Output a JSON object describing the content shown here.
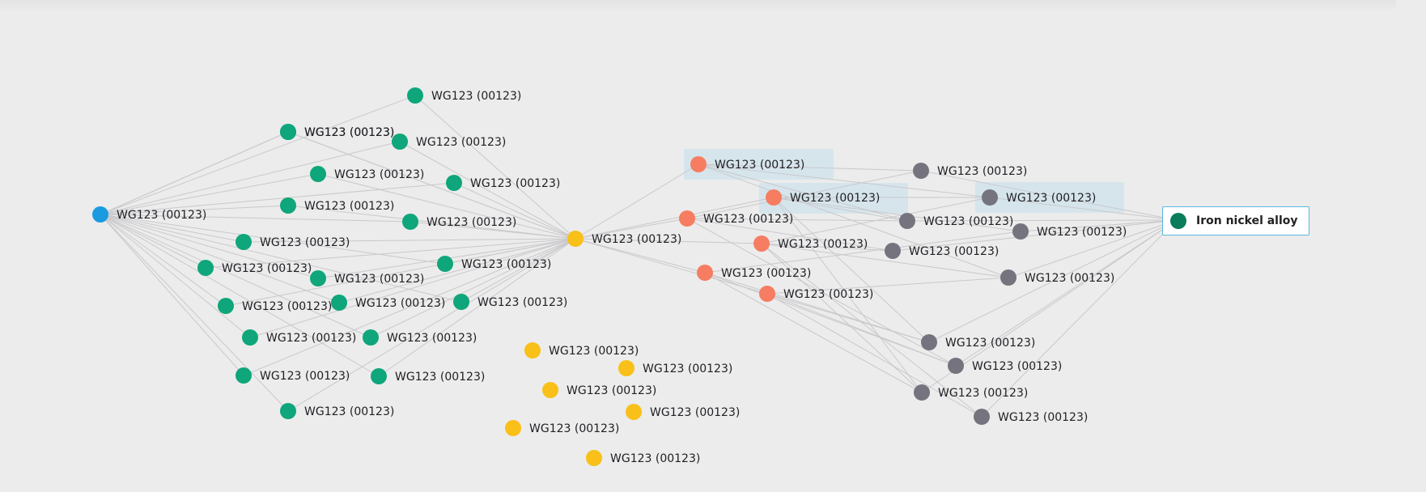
{
  "colors": {
    "background": "#ececec",
    "root": "#1a9be0",
    "hub": "#f8c018",
    "green": "#0ea67a",
    "orange": "#f67d62",
    "gray": "#74737e",
    "edge": "#c9c9cc",
    "legend_dot": "#0b7d5b",
    "legend_border": "#5ab7e0"
  },
  "legend": {
    "label": "Iron nickel alloy",
    "dot_color": "#0b7d5b"
  },
  "nodes": [
    {
      "id": "root",
      "label": "WG123 (00123)",
      "group": "root"
    },
    {
      "id": "g1",
      "label": "WG123 (00123)",
      "group": "green"
    },
    {
      "id": "g2",
      "label": "WG123 (00123)",
      "group": "green"
    },
    {
      "id": "g3",
      "label": "WG123 (00123)",
      "group": "green"
    },
    {
      "id": "g4",
      "label": "WG123 (00123)",
      "group": "green"
    },
    {
      "id": "g5",
      "label": "WG123 (00123)",
      "group": "green"
    },
    {
      "id": "g6",
      "label": "WG123 (00123)",
      "group": "green"
    },
    {
      "id": "g7",
      "label": "WG123 (00123)",
      "group": "green"
    },
    {
      "id": "g8",
      "label": "WG123 (00123)",
      "group": "green"
    },
    {
      "id": "g9",
      "label": "WG123 (00123)",
      "group": "green"
    },
    {
      "id": "g10",
      "label": "WG123 (00123)",
      "group": "green"
    },
    {
      "id": "g11",
      "label": "WG123 (00123)",
      "group": "green"
    },
    {
      "id": "g12",
      "label": "WG123 (00123)",
      "group": "green"
    },
    {
      "id": "g13",
      "label": "WG123 (00123)",
      "group": "green"
    },
    {
      "id": "g14",
      "label": "WG123 (00123)",
      "group": "green"
    },
    {
      "id": "g15",
      "label": "WG123 (00123)",
      "group": "green"
    },
    {
      "id": "g16",
      "label": "WG123 (00123)",
      "group": "green"
    },
    {
      "id": "g17",
      "label": "WG123 (00123)",
      "group": "green"
    },
    {
      "id": "g18",
      "label": "WG123 (00123)",
      "group": "green"
    },
    {
      "id": "g19",
      "label": "WG123 (00123)",
      "group": "green"
    },
    {
      "id": "g20",
      "label": "WG123 (00123)",
      "group": "green"
    },
    {
      "id": "hub",
      "label": "WG123 (00123)",
      "group": "hub"
    },
    {
      "id": "y1",
      "label": "WG123 (00123)",
      "group": "hub"
    },
    {
      "id": "y2",
      "label": "WG123 (00123)",
      "group": "hub"
    },
    {
      "id": "y3",
      "label": "WG123 (00123)",
      "group": "hub"
    },
    {
      "id": "y4",
      "label": "WG123 (00123)",
      "group": "hub"
    },
    {
      "id": "y5",
      "label": "WG123 (00123)",
      "group": "hub"
    },
    {
      "id": "y6",
      "label": "WG123 (00123)",
      "group": "hub"
    },
    {
      "id": "o1",
      "label": "WG123 (00123)",
      "group": "orange",
      "highlighted": true
    },
    {
      "id": "o2",
      "label": "WG123 (00123)",
      "group": "orange",
      "highlighted": true
    },
    {
      "id": "o3",
      "label": "WG123 (00123)",
      "group": "orange"
    },
    {
      "id": "o4",
      "label": "WG123 (00123)",
      "group": "orange"
    },
    {
      "id": "o5",
      "label": "WG123 (00123)",
      "group": "orange"
    },
    {
      "id": "o6",
      "label": "WG123 (00123)",
      "group": "orange"
    },
    {
      "id": "p1",
      "label": "WG123 (00123)",
      "group": "gray"
    },
    {
      "id": "p2",
      "label": "WG123 (00123)",
      "group": "gray",
      "highlighted": true
    },
    {
      "id": "p3",
      "label": "WG123 (00123)",
      "group": "gray"
    },
    {
      "id": "p4",
      "label": "WG123 (00123)",
      "group": "gray"
    },
    {
      "id": "p5",
      "label": "WG123 (00123)",
      "group": "gray"
    },
    {
      "id": "p6",
      "label": "WG123 (00123)",
      "group": "gray"
    },
    {
      "id": "p7",
      "label": "WG123 (00123)",
      "group": "gray"
    },
    {
      "id": "p8",
      "label": "WG123 (00123)",
      "group": "gray"
    },
    {
      "id": "p9",
      "label": "WG123 (00123)",
      "group": "gray"
    },
    {
      "id": "p10",
      "label": "WG123 (00123)",
      "group": "gray"
    }
  ],
  "edges": [
    [
      "root",
      "g1"
    ],
    [
      "root",
      "g2"
    ],
    [
      "root",
      "g3"
    ],
    [
      "root",
      "g4"
    ],
    [
      "root",
      "g5"
    ],
    [
      "root",
      "g6"
    ],
    [
      "root",
      "g7"
    ],
    [
      "root",
      "g8"
    ],
    [
      "root",
      "g9"
    ],
    [
      "root",
      "g10"
    ],
    [
      "root",
      "g11"
    ],
    [
      "root",
      "g12"
    ],
    [
      "root",
      "g13"
    ],
    [
      "root",
      "g14"
    ],
    [
      "root",
      "g15"
    ],
    [
      "root",
      "g16"
    ],
    [
      "root",
      "g17"
    ],
    [
      "root",
      "g18"
    ],
    [
      "root",
      "g19"
    ],
    [
      "root",
      "g20"
    ],
    [
      "hub",
      "g1"
    ],
    [
      "hub",
      "g2"
    ],
    [
      "hub",
      "g3"
    ],
    [
      "hub",
      "g4"
    ],
    [
      "hub",
      "g5"
    ],
    [
      "hub",
      "g6"
    ],
    [
      "hub",
      "g7"
    ],
    [
      "hub",
      "g8"
    ],
    [
      "hub",
      "g9"
    ],
    [
      "hub",
      "g10"
    ],
    [
      "hub",
      "g11"
    ],
    [
      "hub",
      "g12"
    ],
    [
      "hub",
      "g13"
    ],
    [
      "hub",
      "g14"
    ],
    [
      "hub",
      "g15"
    ],
    [
      "hub",
      "g16"
    ],
    [
      "hub",
      "g17"
    ],
    [
      "hub",
      "g18"
    ],
    [
      "hub",
      "g19"
    ],
    [
      "hub",
      "g20"
    ],
    [
      "hub",
      "o1"
    ],
    [
      "hub",
      "o2"
    ],
    [
      "hub",
      "o3"
    ],
    [
      "hub",
      "o4"
    ],
    [
      "hub",
      "o5"
    ],
    [
      "hub",
      "o6"
    ],
    [
      "o1",
      "p1"
    ],
    [
      "o1",
      "p2"
    ],
    [
      "o1",
      "p3"
    ],
    [
      "o1",
      "p6"
    ],
    [
      "o2",
      "p2"
    ],
    [
      "o2",
      "p3"
    ],
    [
      "o2",
      "p4"
    ],
    [
      "o2",
      "p7"
    ],
    [
      "o2",
      "p9"
    ],
    [
      "o3",
      "p1"
    ],
    [
      "o3",
      "p3"
    ],
    [
      "o3",
      "p5"
    ],
    [
      "o3",
      "p8"
    ],
    [
      "o4",
      "p2"
    ],
    [
      "o4",
      "p5"
    ],
    [
      "o4",
      "p6"
    ],
    [
      "o4",
      "p9"
    ],
    [
      "o4",
      "p10"
    ],
    [
      "o5",
      "p4"
    ],
    [
      "o5",
      "p7"
    ],
    [
      "o5",
      "p8"
    ],
    [
      "o5",
      "p9"
    ],
    [
      "o6",
      "p6"
    ],
    [
      "o6",
      "p7"
    ],
    [
      "o6",
      "p8"
    ],
    [
      "o6",
      "p10"
    ],
    [
      "p1",
      "legend"
    ],
    [
      "p2",
      "legend"
    ],
    [
      "p3",
      "legend"
    ],
    [
      "p4",
      "legend"
    ],
    [
      "p5",
      "legend"
    ],
    [
      "p6",
      "legend"
    ],
    [
      "p7",
      "legend"
    ],
    [
      "p8",
      "legend"
    ],
    [
      "p9",
      "legend"
    ],
    [
      "p10",
      "legend"
    ]
  ]
}
